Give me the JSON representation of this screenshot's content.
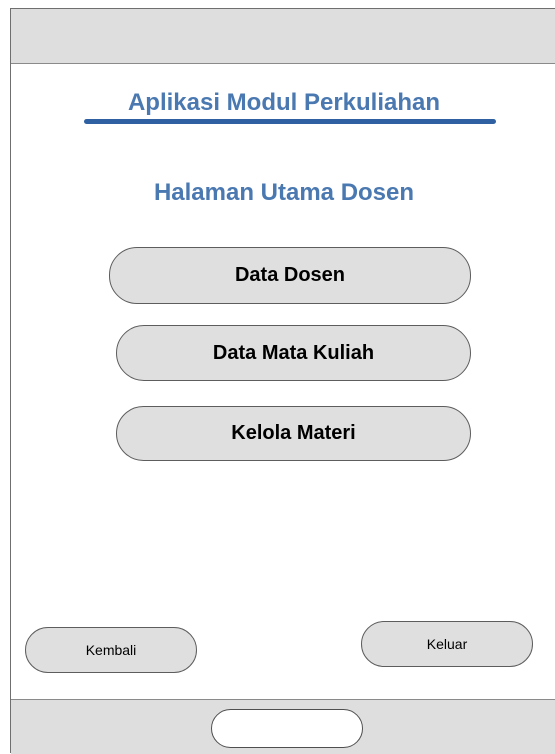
{
  "app": {
    "title": "Aplikasi Modul Perkuliahan"
  },
  "page": {
    "title": "Halaman Utama Dosen"
  },
  "menu": {
    "items": [
      {
        "label": "Data Dosen"
      },
      {
        "label": "Data Mata Kuliah"
      },
      {
        "label": "Kelola Materi"
      }
    ]
  },
  "actions": {
    "back_label": "Kembali",
    "logout_label": "Keluar"
  },
  "colors": {
    "title": "#4a78b0",
    "underline": "#2f61a2",
    "button_fill": "#dfdfdf",
    "bar_fill": "#dedede"
  }
}
